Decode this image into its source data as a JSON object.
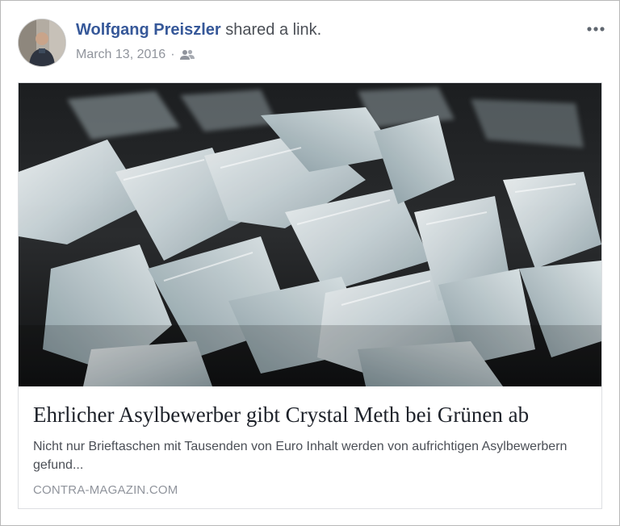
{
  "post": {
    "author_name": "Wolfgang Preiszler",
    "action_text": "shared a link.",
    "date": "March 13, 2016",
    "separator": "·",
    "audience_icon": "friends-icon",
    "menu_icon": "more-options-icon"
  },
  "link": {
    "image_description_icon": "crystals-photo",
    "title": "Ehrlicher Asylbewerber gibt Crystal Meth bei Grünen ab",
    "description": "Nicht nur Brieftaschen mit Tausenden von Euro Inhalt werden von aufrichtigen Asylbewerbern gefund...",
    "domain": "CONTRA-MAGAZIN.COM"
  },
  "colors": {
    "author_link": "#365899",
    "meta_text": "#90949c",
    "title_text": "#1d2129",
    "border": "#dddfe2"
  }
}
